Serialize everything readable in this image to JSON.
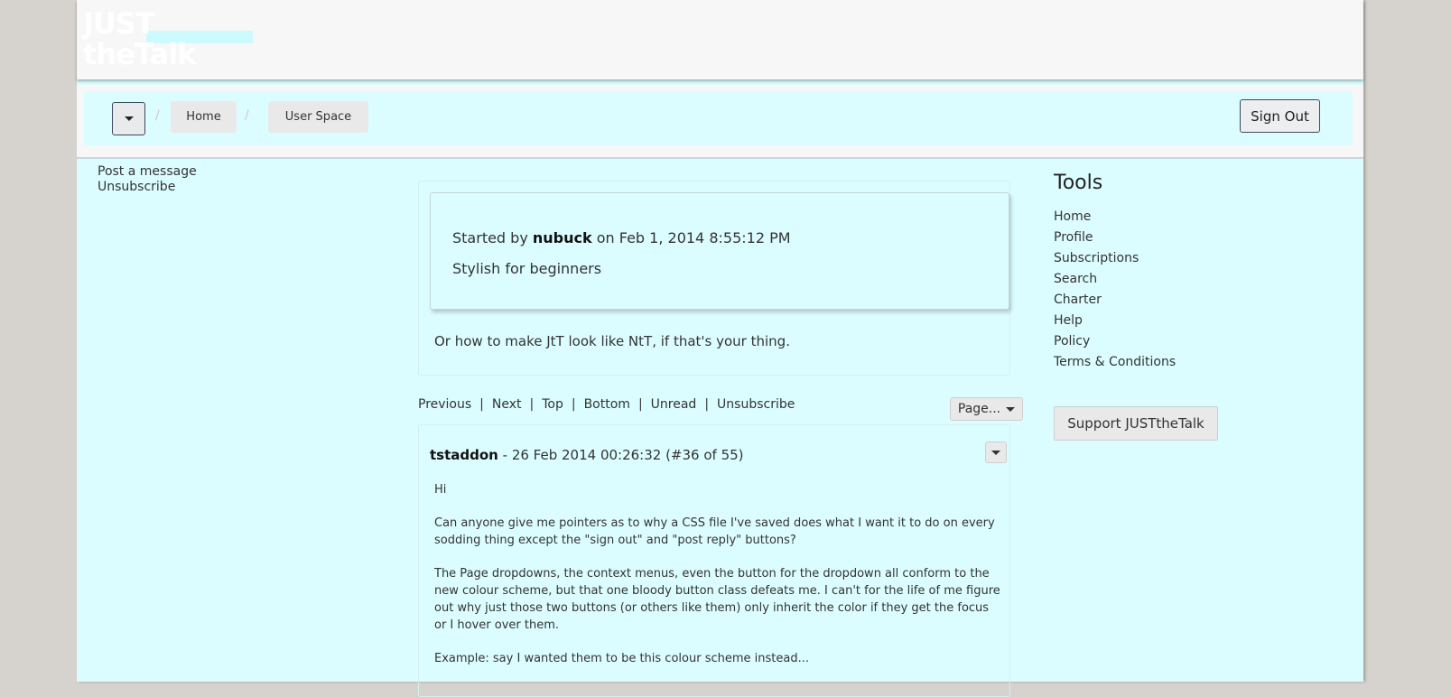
{
  "logo": {
    "line1": "JUST",
    "line2": "theTalk"
  },
  "nav": {
    "breadcrumbs": [
      "Home",
      "User Space"
    ],
    "separator": "/",
    "sign_out": "Sign Out"
  },
  "left_links": [
    "Post a message",
    "Unsubscribe"
  ],
  "thread": {
    "started_prefix": "Started by",
    "author": "nubuck",
    "date": "on Feb 1, 2014 8:55:12 PM",
    "title": "Stylish for beginners",
    "description": "Or how to make JtT look like NtT, if that's your thing."
  },
  "pager": {
    "links": [
      "Previous",
      "Next",
      "Top",
      "Bottom",
      "Unread",
      "Unsubscribe"
    ],
    "separator": "|",
    "page_label": "Page..."
  },
  "post": {
    "author": "tstaddon",
    "meta": "- 26 Feb 2014 00:26:32 (#36 of 55)",
    "paragraphs": [
      "Hi",
      "Can anyone give me pointers as to why a CSS file I've saved does what I want it to do on every sodding thing except the \"sign out\" and \"post reply\" buttons?",
      "The Page dropdowns, the context menus, even the button for the dropdown all conform to the new colour scheme, but that one bloody button class defeats me. I can't for the life of me figure out why just those two buttons (or others like them) only inherit the color if they get the focus or I hover over them.",
      "Example: say I wanted them to be this colour scheme instead..."
    ]
  },
  "tools": {
    "title": "Tools",
    "items": [
      "Home",
      "Profile",
      "Subscriptions",
      "Search",
      "Charter",
      "Help",
      "Policy",
      "Terms & Conditions"
    ],
    "support": "Support JUSTtheTalk"
  },
  "icons": {
    "menu_toggle": "caret-down-icon",
    "page_select": "caret-down-icon",
    "post_menu": "caret-down-icon"
  },
  "colors": {
    "background": "#d6d3ce",
    "page": "#dcfdff",
    "header": "#f7f7f7"
  }
}
